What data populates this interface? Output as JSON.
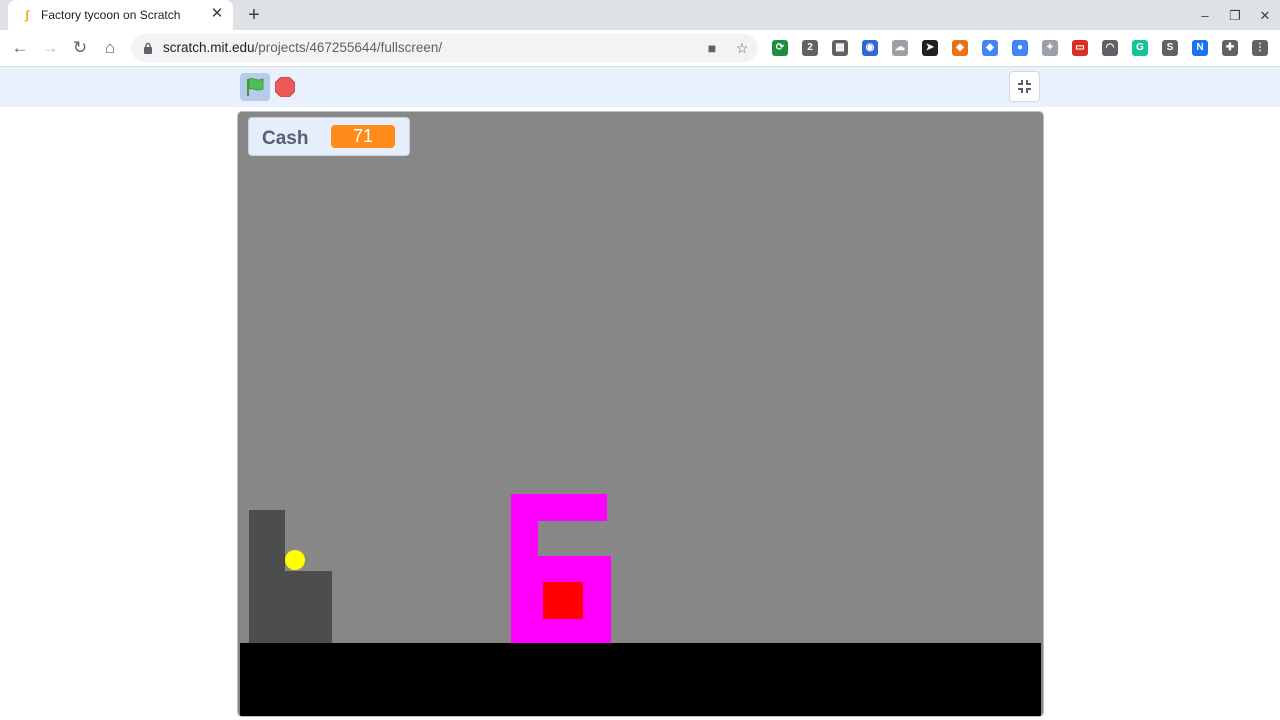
{
  "browser": {
    "tab_title": "Factory tycoon on Scratch",
    "tab_favicon": "scratch-favicon-icon",
    "url_host": "scratch.mit.edu",
    "url_path": "/projects/467255644/fullscreen/",
    "extensions": [
      {
        "icon": "extension-icon",
        "color": "#1e8e3e",
        "text": "⟳"
      },
      {
        "icon": "extension-icon",
        "color": "#5f6368",
        "text": "2"
      },
      {
        "icon": "extension-icon",
        "color": "#5f6368",
        "text": "▦"
      },
      {
        "icon": "extension-icon",
        "color": "#3367d6",
        "text": "◉"
      },
      {
        "icon": "extension-icon",
        "color": "#9aa0a6",
        "text": "☁"
      },
      {
        "icon": "extension-icon",
        "color": "#202124",
        "text": "➤"
      },
      {
        "icon": "extension-icon",
        "color": "#e8711a",
        "text": "◈"
      },
      {
        "icon": "extension-icon",
        "color": "#4285f4",
        "text": "◆"
      },
      {
        "icon": "extension-icon",
        "color": "#4285f4",
        "text": "●"
      },
      {
        "icon": "puzzle-icon",
        "color": "#9aa0a6",
        "text": "✦"
      },
      {
        "icon": "extension-icon",
        "color": "#d93025",
        "text": "▭"
      },
      {
        "icon": "extension-icon",
        "color": "#5f6368",
        "text": "◠"
      },
      {
        "icon": "grammarly-icon",
        "color": "#15c39a",
        "text": "G"
      },
      {
        "icon": "extension-icon",
        "color": "#5f6368",
        "text": "S"
      },
      {
        "icon": "extension-icon",
        "color": "#1a73e8",
        "text": "N"
      },
      {
        "icon": "extensions-puzzle-icon",
        "color": "#5f6368",
        "text": "✚"
      },
      {
        "icon": "kebab-menu-icon",
        "color": "#5f6368",
        "text": "⋮"
      }
    ]
  },
  "scratch": {
    "monitor": {
      "label": "Cash",
      "value": "71"
    },
    "colors": {
      "stage_bg": "#878787",
      "ground": "#000000",
      "factory": "#4d4d4d",
      "sun": "#ffff00",
      "magenta": "#ff00ff",
      "red": "#ff0000",
      "monitor_value_bg": "#ff8c1a"
    }
  }
}
